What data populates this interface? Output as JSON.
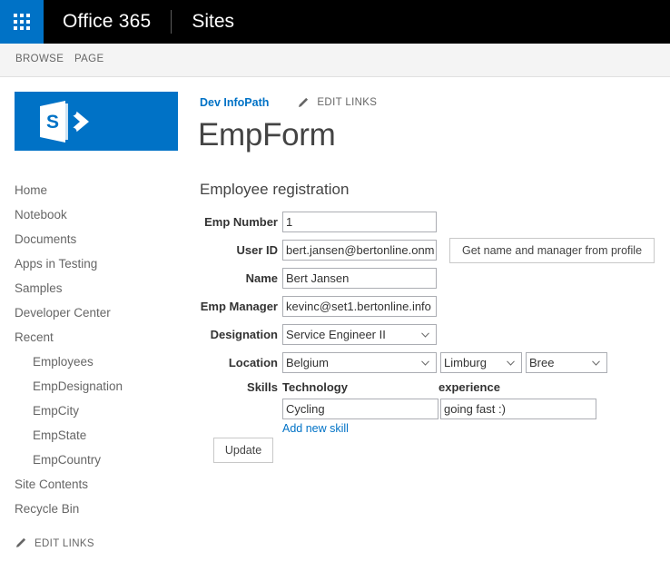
{
  "suite": {
    "waffle_icon": "app-launcher-waffle-icon",
    "brand": "Office 365",
    "app": "Sites"
  },
  "ribbon": {
    "tabs": [
      {
        "label": "BROWSE"
      },
      {
        "label": "PAGE"
      }
    ]
  },
  "logo": {
    "name": "sharepoint-logo",
    "letter": "S",
    "color": "#0072c6"
  },
  "breadcrumb": {
    "site_link": "Dev InfoPath",
    "edit_links": "EDIT LINKS",
    "pencil_icon": "pencil-icon"
  },
  "page": {
    "title": "EmpForm",
    "section_title": "Employee registration"
  },
  "sidebar": {
    "items": [
      {
        "label": "Home",
        "child": false
      },
      {
        "label": "Notebook",
        "child": false
      },
      {
        "label": "Documents",
        "child": false
      },
      {
        "label": "Apps in Testing",
        "child": false
      },
      {
        "label": "Samples",
        "child": false
      },
      {
        "label": "Developer Center",
        "child": false
      },
      {
        "label": "Recent",
        "child": false
      },
      {
        "label": "Employees",
        "child": true
      },
      {
        "label": "EmpDesignation",
        "child": true
      },
      {
        "label": "EmpCity",
        "child": true
      },
      {
        "label": "EmpState",
        "child": true
      },
      {
        "label": "EmpCountry",
        "child": true
      },
      {
        "label": "Site Contents",
        "child": false
      },
      {
        "label": "Recycle Bin",
        "child": false
      }
    ],
    "edit_links": "EDIT LINKS",
    "pencil_icon": "pencil-icon"
  },
  "form": {
    "fields": {
      "emp_number": {
        "label": "Emp Number",
        "value": "1"
      },
      "user_id": {
        "label": "User ID",
        "value": "bert.jansen@bertonline.onmi"
      },
      "name": {
        "label": "Name",
        "value": "Bert Jansen"
      },
      "emp_manager": {
        "label": "Emp Manager",
        "value": "kevinc@set1.bertonline.info"
      },
      "designation": {
        "label": "Designation",
        "value": "Service Engineer II"
      },
      "location": {
        "label": "Location",
        "country": "Belgium",
        "state": "Limburg",
        "city": "Bree"
      }
    },
    "profile_button": "Get name and manager from profile",
    "skills": {
      "label": "Skills",
      "col_technology": "Technology",
      "col_experience": "experience",
      "rows": [
        {
          "technology": "Cycling",
          "experience": "going fast :)"
        }
      ],
      "add_link": "Add new skill"
    },
    "update_button": "Update"
  },
  "colors": {
    "accent": "#0072c6",
    "suitebar": "#000000",
    "ribbon": "#f4f4f4",
    "text": "#444444"
  }
}
